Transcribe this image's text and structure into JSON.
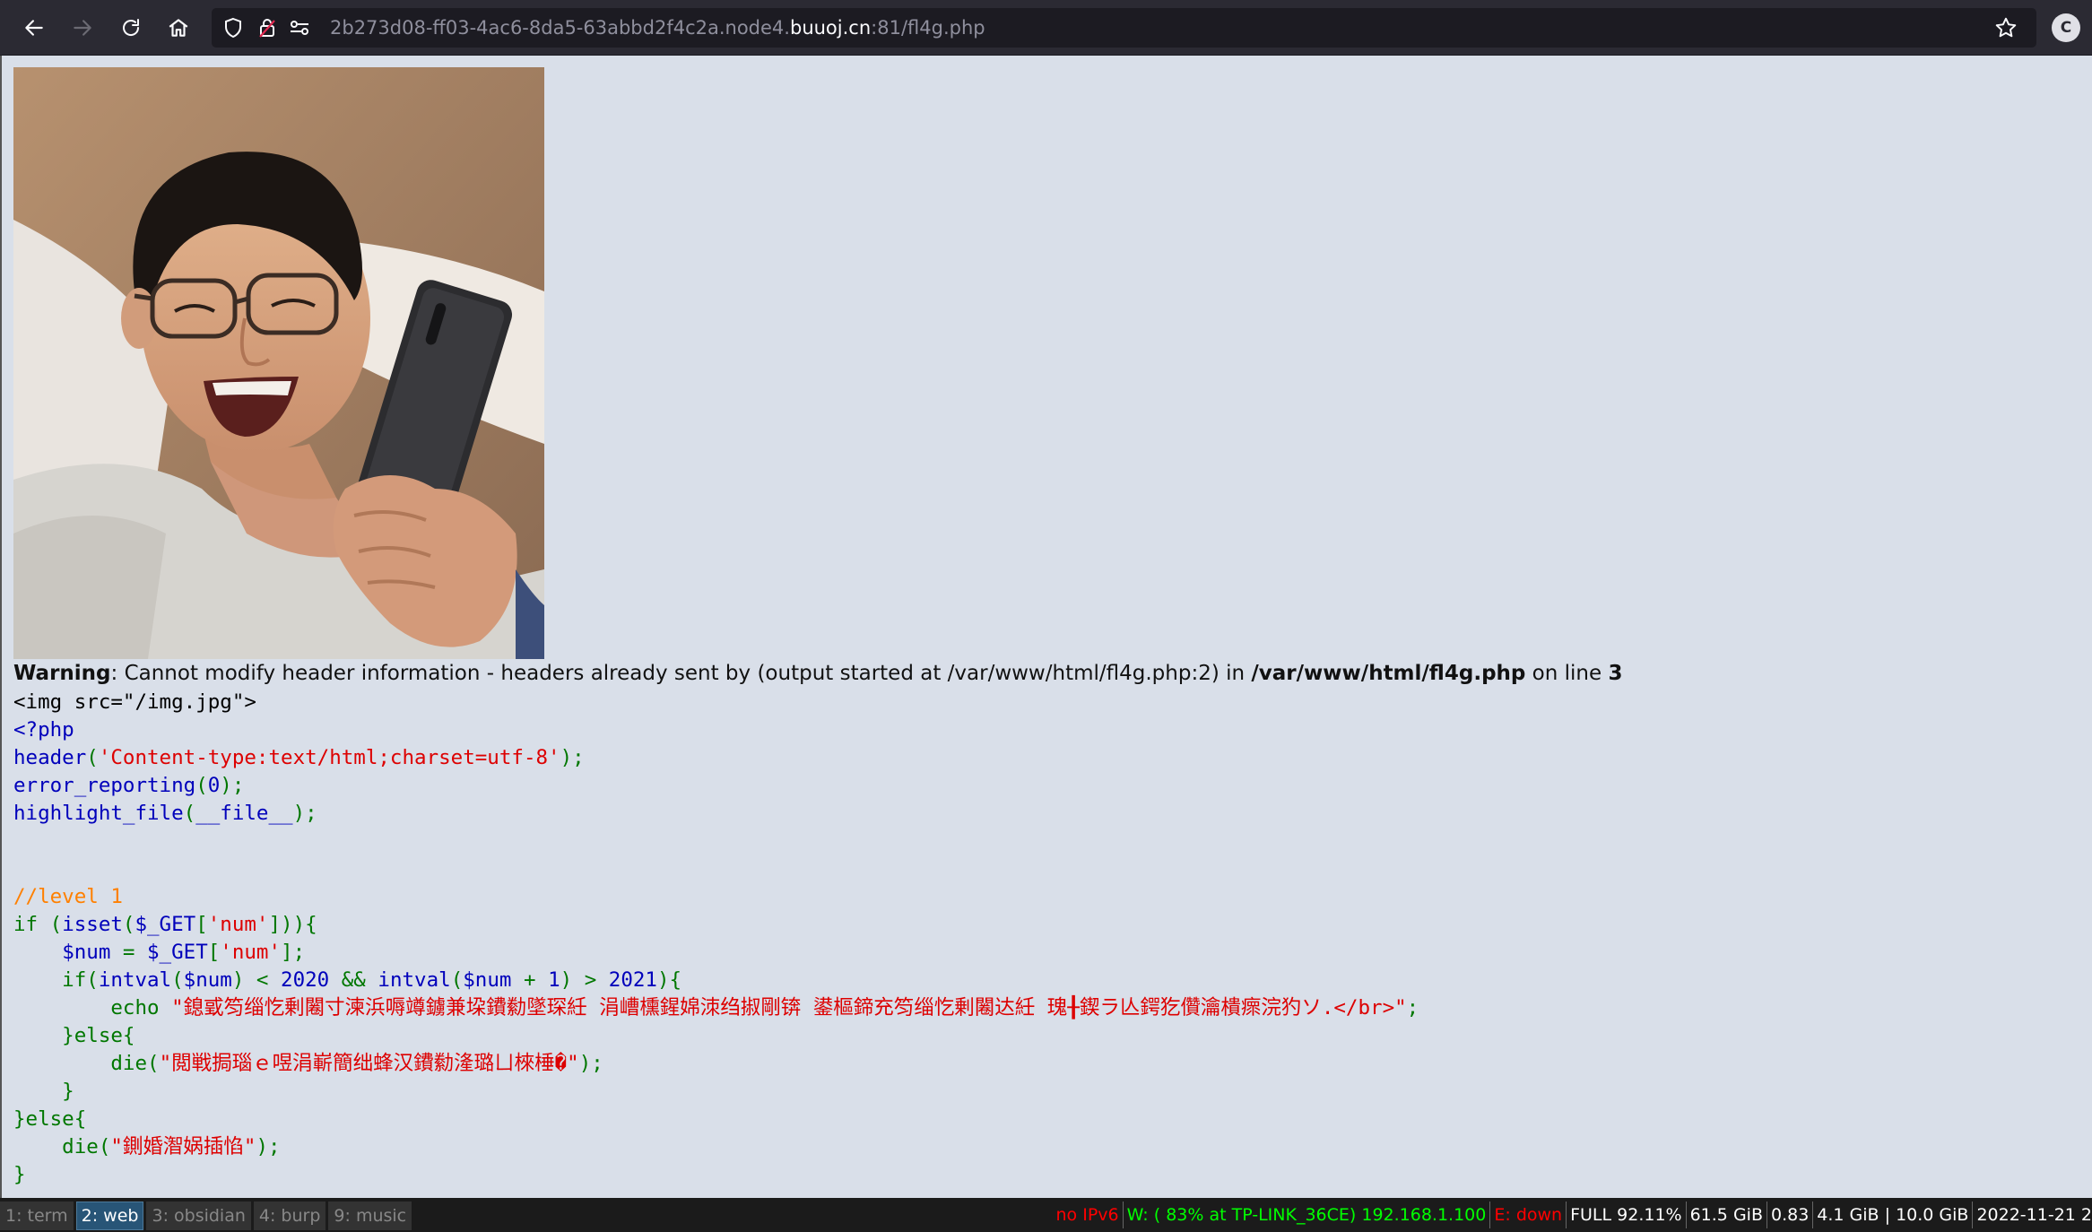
{
  "browser": {
    "url_prefix": "2b273d08-ff03-4ac6-8da5-63abbd2f4c2a.node4.",
    "url_domain": "buuoj.cn",
    "url_suffix": ":81/fl4g.php",
    "profile_initial": "C",
    "icons": {
      "back": "back-arrow-icon",
      "forward": "forward-arrow-icon",
      "reload": "reload-icon",
      "home": "home-icon",
      "shield": "tracking-shield-icon",
      "lock": "insecure-lock-icon",
      "permissions": "permissions-icon",
      "bookmark": "star-icon"
    }
  },
  "warning": {
    "label": "Warning",
    "message": ": Cannot modify header information - headers already sent by (output started at /var/www/html/fl4g.php:2) in ",
    "file": "/var/www/html/fl4g.php",
    "on_line": " on line ",
    "line": "3"
  },
  "code_lines": [
    [
      {
        "t": "<img src=\"/img.jpg\">",
        "c": "html"
      }
    ],
    [
      {
        "t": "<?php",
        "c": "default"
      }
    ],
    [
      {
        "t": "header",
        "c": "default"
      },
      {
        "t": "(",
        "c": "keyword"
      },
      {
        "t": "'Content-type:text/html;charset=utf-8'",
        "c": "string"
      },
      {
        "t": ");",
        "c": "keyword"
      }
    ],
    [
      {
        "t": "error_reporting",
        "c": "default"
      },
      {
        "t": "(",
        "c": "keyword"
      },
      {
        "t": "0",
        "c": "default"
      },
      {
        "t": ");",
        "c": "keyword"
      }
    ],
    [
      {
        "t": "highlight_file",
        "c": "default"
      },
      {
        "t": "(",
        "c": "keyword"
      },
      {
        "t": "__file__",
        "c": "default"
      },
      {
        "t": ");",
        "c": "keyword"
      }
    ],
    [],
    [],
    [
      {
        "t": "//level 1",
        "c": "comment"
      }
    ],
    [
      {
        "t": "if (",
        "c": "keyword"
      },
      {
        "t": "isset",
        "c": "default"
      },
      {
        "t": "(",
        "c": "keyword"
      },
      {
        "t": "$_GET",
        "c": "default"
      },
      {
        "t": "[",
        "c": "keyword"
      },
      {
        "t": "'num'",
        "c": "string"
      },
      {
        "t": "])){",
        "c": "keyword"
      }
    ],
    [
      {
        "t": "    ",
        "c": "keyword"
      },
      {
        "t": "$num ",
        "c": "default"
      },
      {
        "t": "= ",
        "c": "keyword"
      },
      {
        "t": "$_GET",
        "c": "default"
      },
      {
        "t": "[",
        "c": "keyword"
      },
      {
        "t": "'num'",
        "c": "string"
      },
      {
        "t": "];",
        "c": "keyword"
      }
    ],
    [
      {
        "t": "    if(",
        "c": "keyword"
      },
      {
        "t": "intval",
        "c": "default"
      },
      {
        "t": "(",
        "c": "keyword"
      },
      {
        "t": "$num",
        "c": "default"
      },
      {
        "t": ") < ",
        "c": "keyword"
      },
      {
        "t": "2020 ",
        "c": "default"
      },
      {
        "t": "&& ",
        "c": "keyword"
      },
      {
        "t": "intval",
        "c": "default"
      },
      {
        "t": "(",
        "c": "keyword"
      },
      {
        "t": "$num ",
        "c": "default"
      },
      {
        "t": "+ ",
        "c": "keyword"
      },
      {
        "t": "1",
        "c": "default"
      },
      {
        "t": ") > ",
        "c": "keyword"
      },
      {
        "t": "2021",
        "c": "default"
      },
      {
        "t": "){",
        "c": "keyword"
      }
    ],
    [
      {
        "t": "        echo ",
        "c": "keyword"
      },
      {
        "t": "\"鎴戜笉缁忔剰闂寸湅浜嗕竴鐪兼垜鐨勬墜琛紝 涓嶆櫄鍟婂洓绉掓剛锛 鍙樞鍗充笉缁忔剰闂达紝 瑰╂鍥ラ亾鍔犵儹瀹樻瘝浣犳ソ.</br>\"",
        "c": "string"
      },
      {
        "t": ";",
        "c": "keyword"
      }
    ],
    [
      {
        "t": "    }else{",
        "c": "keyword"
      }
    ],
    [
      {
        "t": "        die",
        "c": "keyword"
      },
      {
        "t": "(",
        "c": "keyword"
      },
      {
        "t": "\"閲戦挶瑙ｅ喅涓嶄簡绌蜂汉鐨勬湰璐ㄩ棶棰�\"",
        "c": "string"
      },
      {
        "t": ");",
        "c": "keyword"
      }
    ],
    [
      {
        "t": "    }",
        "c": "keyword"
      }
    ],
    [
      {
        "t": "}else{",
        "c": "keyword"
      }
    ],
    [
      {
        "t": "    die",
        "c": "keyword"
      },
      {
        "t": "(",
        "c": "keyword"
      },
      {
        "t": "\"鍘婚潪娲插惂\"",
        "c": "string"
      },
      {
        "t": ");",
        "c": "keyword"
      }
    ],
    [
      {
        "t": "}",
        "c": "keyword"
      }
    ]
  ],
  "taskbar": {
    "workspaces": [
      {
        "label": "1: term",
        "active": false
      },
      {
        "label": "2: web",
        "active": true
      },
      {
        "label": "3: obsidian",
        "active": false
      },
      {
        "label": "4: burp",
        "active": false
      },
      {
        "label": "9: music",
        "active": false
      }
    ],
    "status": [
      {
        "text": "no IPv6",
        "color": "red"
      },
      {
        "text": "W: ( 83% at TP-LINK_36CE) 192.168.1.100",
        "color": "green"
      },
      {
        "text": "E: down",
        "color": "red"
      },
      {
        "text": "FULL 92.11%",
        "color": "white"
      },
      {
        "text": "61.5 GiB",
        "color": "white"
      },
      {
        "text": "0.83",
        "color": "white"
      },
      {
        "text": "4.1 GiB | 10.0 GiB",
        "color": "white"
      },
      {
        "text": "2022-11-21 2",
        "color": "white"
      }
    ]
  },
  "colors": {
    "page_bg": "#d9dfe9",
    "php_default": "#0000bb",
    "php_keyword": "#007700",
    "php_string": "#dd0000",
    "php_comment": "#ff8000"
  }
}
